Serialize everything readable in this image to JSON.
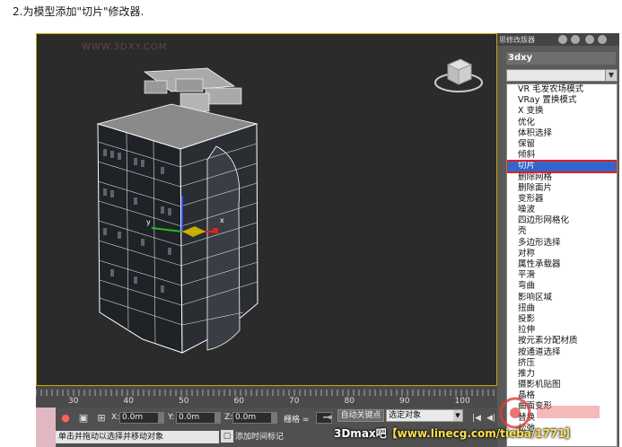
{
  "caption": "2.为模型添加\"切片\"修改器.",
  "viewport": {
    "watermark": "WWW.3DXY.COM"
  },
  "command_panel": {
    "tabs_label": "思修改版器",
    "object_name": "3dxy",
    "modifier_list": {
      "items": [
        "VR 毛发农场模式",
        "VRay 置换模式",
        "X 变换",
        "优化",
        "体积选择",
        "保留",
        "倾斜",
        "切片",
        "删除网格",
        "删除面片",
        "变形器",
        "噪波",
        "四边形网格化",
        "壳",
        "多边形选择",
        "对称",
        "属性承载器",
        "平滑",
        "弯曲",
        "影响区域",
        "扭曲",
        "投影",
        "拉伸",
        "按元素分配材质",
        "按通道选择",
        "挤压",
        "推力",
        "摄影机贴图",
        "晶格",
        "曲面变形",
        "替换",
        "松弛"
      ],
      "selected": "切片"
    }
  },
  "timeline": {
    "ticks": [
      "30",
      "40",
      "50",
      "60",
      "70",
      "80",
      "90",
      "100"
    ]
  },
  "statusbar": {
    "x_label": "X:",
    "x_value": "0.0m",
    "y_label": "Y:",
    "y_value": "0.0m",
    "z_label": "Z:",
    "z_value": "0.0m",
    "grid_label": "栅格 =",
    "auto_key_label": "自动关键点",
    "selection_set": "选定对象",
    "prompt": "单击并拖动以选择并移动对象",
    "add_time_tag": "添加时间标记"
  },
  "watermark_bottom": {
    "part1": "3Dmax吧",
    "part2": "【www.linecg.com/tieba/1771】"
  }
}
